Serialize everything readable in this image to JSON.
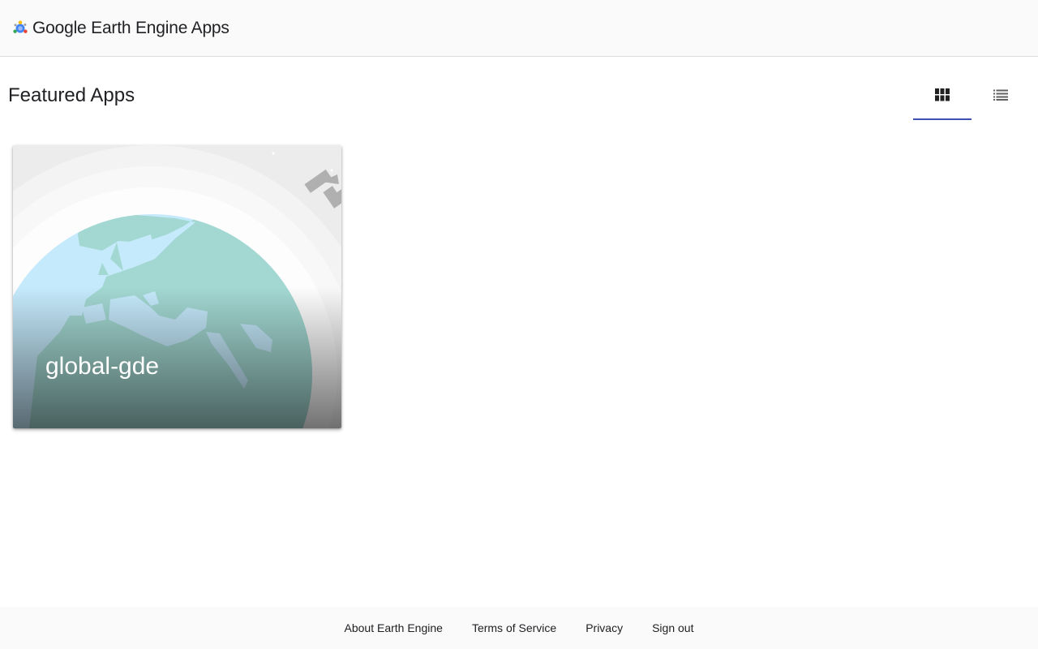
{
  "header": {
    "title": "Google Earth Engine Apps",
    "logo_icon": "earth-engine-logo-icon"
  },
  "main": {
    "section_title": "Featured Apps",
    "view_toggle": {
      "selected": "grid",
      "options": [
        {
          "icon": "grid-view-icon",
          "active": true
        },
        {
          "icon": "list-view-icon",
          "active": false
        }
      ]
    },
    "apps": [
      {
        "name": "global-gde",
        "thumbnail": "earth-satellite-illustration"
      }
    ]
  },
  "footer": {
    "links": [
      "About Earth Engine",
      "Terms of Service",
      "Privacy",
      "Sign out"
    ]
  },
  "colors": {
    "accent": "#3f51b5",
    "header_bg": "#fafafa",
    "footer_bg": "#fafafa",
    "ocean": "#c5eafc",
    "land": "#a3d8d2"
  }
}
